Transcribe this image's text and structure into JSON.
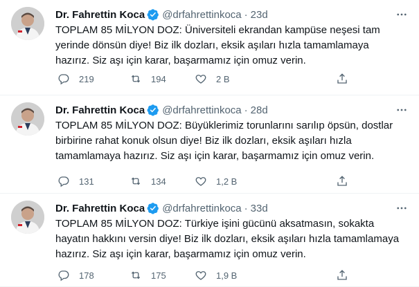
{
  "tweets": [
    {
      "name": "Dr. Fahrettin Koca",
      "handle": "@drfahrettinkoca",
      "separator": "·",
      "age": "23d",
      "text": "TOPLAM 85 MİLYON DOZ: Üniversiteli ekrandan kampüse neşesi tam yerinde dönsün diye! Biz ilk dozları, eksik aşıları hızla tamamlamaya hazırız. Siz aşı için karar, başarmamız için omuz verin.",
      "replies": "219",
      "retweets": "194",
      "likes": "2 B"
    },
    {
      "name": "Dr. Fahrettin Koca",
      "handle": "@drfahrettinkoca",
      "separator": "·",
      "age": "28d",
      "text": "TOPLAM 85 MİLYON DOZ: Büyüklerimiz torunlarını sarılıp öpsün, dostlar birbirine rahat konuk olsun diye! Biz ilk dozları, eksik aşıları hızla tamamlamaya hazırız. Siz aşı için karar, başarmamız için omuz verin.",
      "replies": "131",
      "retweets": "134",
      "likes": "1,2 B"
    },
    {
      "name": "Dr. Fahrettin Koca",
      "handle": "@drfahrettinkoca",
      "separator": "·",
      "age": "33d",
      "text": "TOPLAM 85 MİLYON DOZ: Türkiye işini gücünü aksatmasın, sokakta hayatın hakkını versin diye! Biz ilk dozları, eksik aşıları hızla tamamlamaya hazırız. Siz aşı için karar, başarmamız için omuz verin.",
      "replies": "178",
      "retweets": "175",
      "likes": "1,9 B"
    }
  ],
  "colors": {
    "verified": "#1d9bf0",
    "muted": "#536471",
    "text": "#0f1419",
    "divider": "#eff3f4"
  },
  "icons": [
    "verified-badge-icon",
    "more-icon",
    "reply-icon",
    "retweet-icon",
    "like-icon",
    "share-icon"
  ]
}
